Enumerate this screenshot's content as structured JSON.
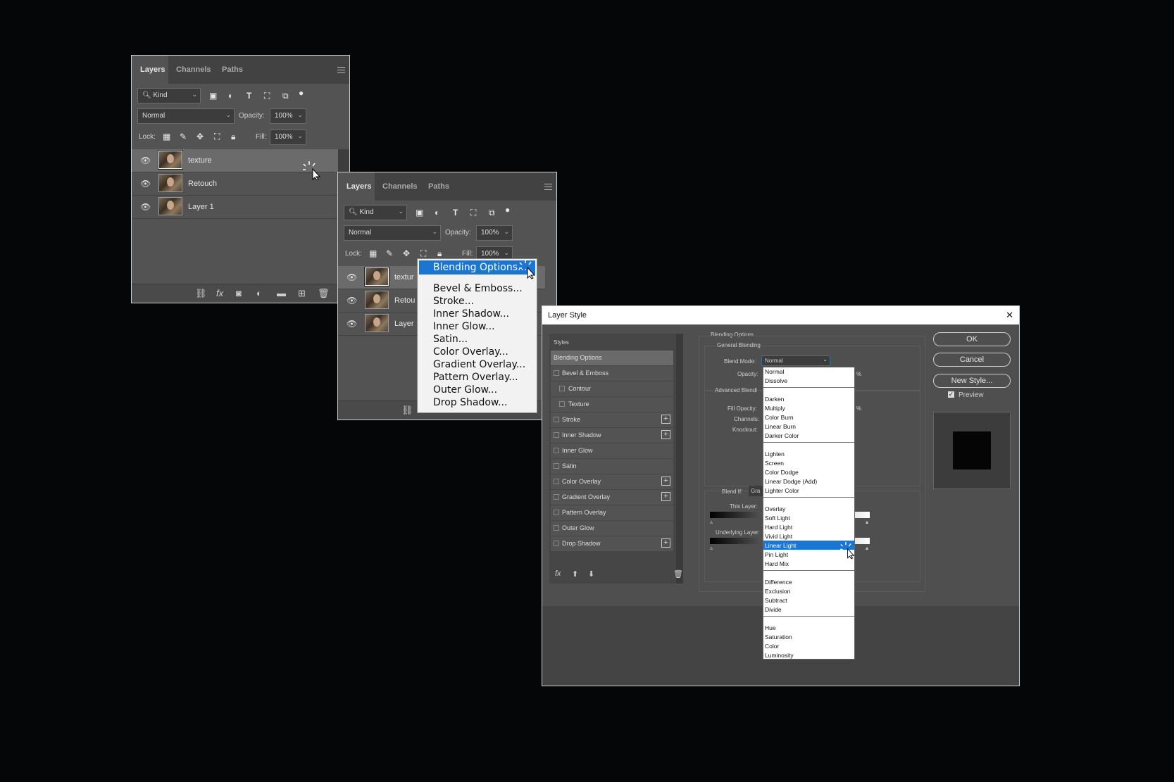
{
  "layers_panel_1": {
    "tabs": [
      "Layers",
      "Channels",
      "Paths"
    ],
    "filter_kind": "Kind",
    "blend_mode": "Normal",
    "opacity_label": "Opacity:",
    "opacity_value": "100%",
    "lock_label": "Lock:",
    "fill_label": "Fill:",
    "fill_value": "100%",
    "layers": [
      "texture",
      "Retouch",
      "Layer 1"
    ]
  },
  "layers_panel_2": {
    "tabs": [
      "Layers",
      "Channels",
      "Paths"
    ],
    "filter_kind": "Kind",
    "blend_mode": "Normal",
    "opacity_label": "Opacity:",
    "opacity_value": "100%",
    "lock_label": "Lock:",
    "fill_label": "Fill:",
    "fill_value": "100%",
    "layers": [
      "textur",
      "Retou",
      "Layer"
    ]
  },
  "context_menu": {
    "items": [
      "Blending Options...",
      "Bevel & Emboss...",
      "Stroke...",
      "Inner Shadow...",
      "Inner Glow...",
      "Satin...",
      "Color Overlay...",
      "Gradient Overlay...",
      "Pattern Overlay...",
      "Outer Glow...",
      "Drop Shadow..."
    ]
  },
  "layer_style": {
    "title": "Layer Style",
    "close": "✕",
    "styles_header": "Styles",
    "style_items": [
      "Blending Options",
      "Bevel & Emboss",
      "Contour",
      "Texture",
      "Stroke",
      "Inner Shadow",
      "Inner Glow",
      "Satin",
      "Color Overlay",
      "Gradient Overlay",
      "Pattern Overlay",
      "Outer Glow",
      "Drop Shadow"
    ],
    "buttons": {
      "ok": "OK",
      "cancel": "Cancel",
      "new_style": "New Style..."
    },
    "preview_label": "Preview",
    "blending_options_title": "Blending Options",
    "general_blending": "General Blending",
    "blend_mode_label": "Blend Mode:",
    "blend_mode_value": "Normal",
    "opacity_label": "Opacity:",
    "pct": "%",
    "advanced_blending": "Advanced Blendi",
    "fill_opacity_label": "Fill Opacity:",
    "channels_label": "Channels:",
    "knockout_label": "Knockout:",
    "blend_if_label": "Blend If:",
    "blend_if_value": "Gra",
    "this_layer_label": "This Layer:",
    "underlying_layer_label": "Underlying Layer:",
    "blend_modes": [
      [
        "Normal",
        "Dissolve"
      ],
      [
        "Darken",
        "Multiply",
        "Color Burn",
        "Linear Burn",
        "Darker Color"
      ],
      [
        "Lighten",
        "Screen",
        "Color Dodge",
        "Linear Dodge (Add)",
        "Lighter Color"
      ],
      [
        "Overlay",
        "Soft Light",
        "Hard Light",
        "Vivid Light",
        "Linear Light",
        "Pin Light",
        "Hard Mix"
      ],
      [
        "Difference",
        "Exclusion",
        "Subtract",
        "Divide"
      ],
      [
        "Hue",
        "Saturation",
        "Color",
        "Luminosity"
      ]
    ],
    "selected_blend_mode": "Linear Light"
  },
  "colors": {
    "highlight": "#1b76d2",
    "panel": "#535353",
    "background": "#040608"
  }
}
